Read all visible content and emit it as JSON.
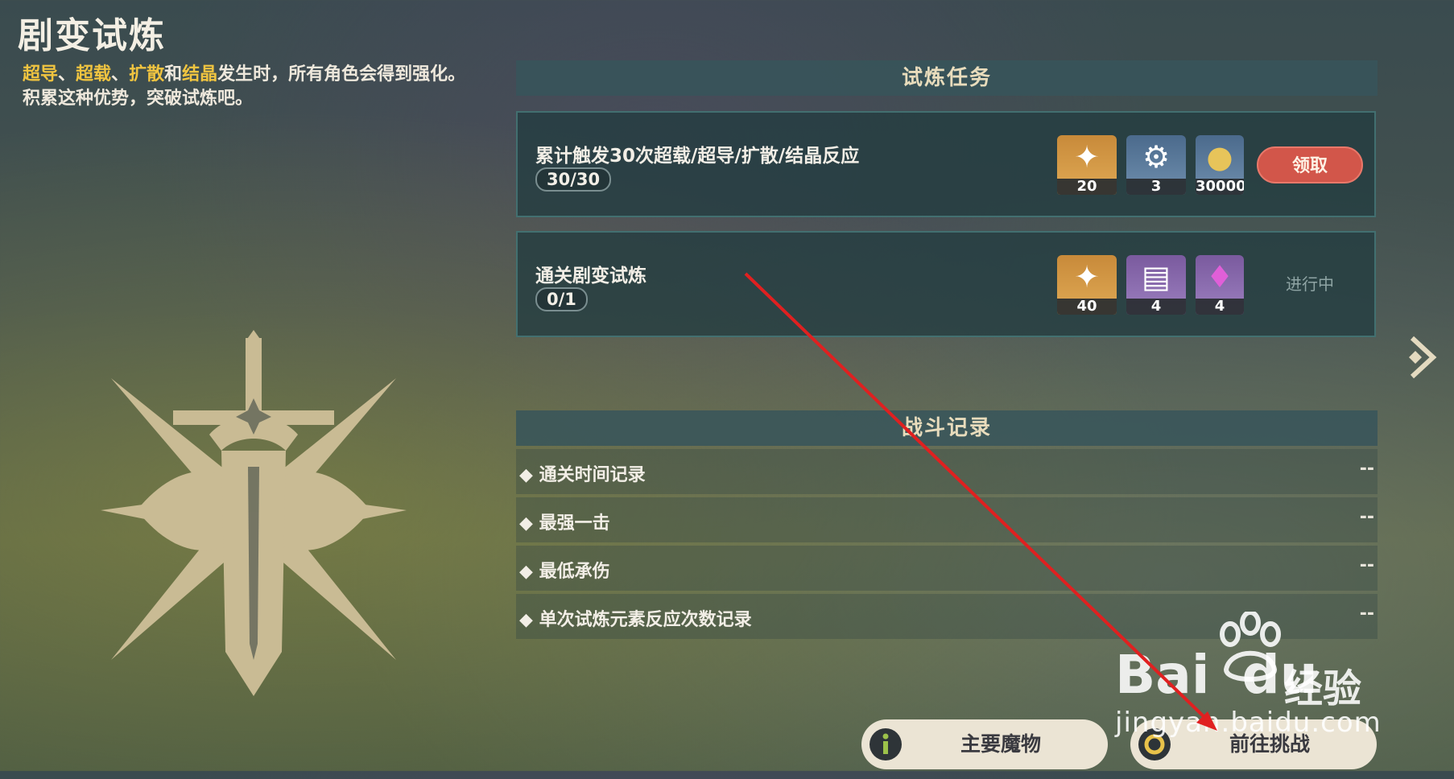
{
  "page": {
    "title": "剧变试炼"
  },
  "description": {
    "parts": [
      {
        "text": "超导",
        "highlight": true
      },
      {
        "text": "、",
        "highlight": false
      },
      {
        "text": "超载",
        "highlight": true
      },
      {
        "text": "、",
        "highlight": false
      },
      {
        "text": "扩散",
        "highlight": true
      },
      {
        "text": "和",
        "highlight": false
      },
      {
        "text": "结晶",
        "highlight": true
      },
      {
        "text": "发生时，所有角色会得到强化。积累这种优势，突破试炼吧。",
        "highlight": false
      }
    ]
  },
  "tasks": {
    "header": "试炼任务",
    "items": [
      {
        "title": "累计触发30次超载/超导/扩散/结晶反应",
        "progress": "30/30",
        "rewards": [
          {
            "icon": "primogem-icon",
            "count": "20"
          },
          {
            "icon": "weapon-ore-icon",
            "count": "3"
          },
          {
            "icon": "mora-icon",
            "count": "30000"
          }
        ],
        "action": "领取"
      },
      {
        "title": "通关剧变试炼",
        "progress": "0/1",
        "rewards": [
          {
            "icon": "primogem-icon",
            "count": "40"
          },
          {
            "icon": "exp-book-icon",
            "count": "4"
          },
          {
            "icon": "crystal-icon",
            "count": "4"
          }
        ],
        "status": "进行中"
      }
    ]
  },
  "records": {
    "header": "战斗记录",
    "items": [
      {
        "label": "◆ 通关时间记录",
        "value": "--"
      },
      {
        "label": "◆ 最强一击",
        "value": "--"
      },
      {
        "label": "◆ 最低承伤",
        "value": "--"
      },
      {
        "label": "◆ 单次试炼元素反应次数记录",
        "value": "--"
      }
    ]
  },
  "buttons": {
    "monsters": "主要魔物",
    "challenge": "前往挑战"
  },
  "watermark": {
    "brand": "Bai",
    "brand2": "du",
    "jingyan": "经验",
    "url": "jingyan.baidu.com"
  },
  "colors": {
    "highlight": "#f0c440",
    "claim": "#d2564a",
    "annotation_arrow": "#e02020"
  }
}
